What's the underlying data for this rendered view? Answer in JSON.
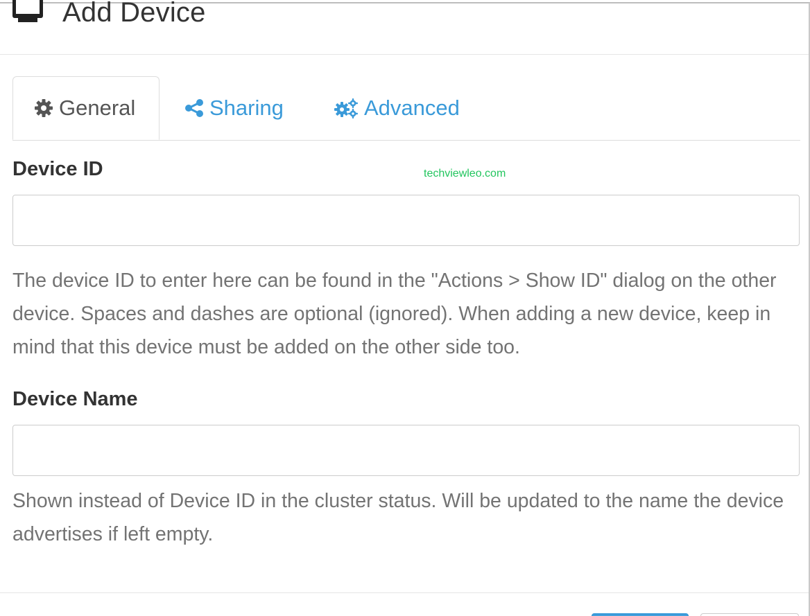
{
  "header": {
    "title": "Add Device",
    "icon": "desktop-icon"
  },
  "tabs": [
    {
      "label": "General",
      "icon": "gear-icon",
      "active": true
    },
    {
      "label": "Sharing",
      "icon": "share-icon",
      "active": false
    },
    {
      "label": "Advanced",
      "icon": "cogs-icon",
      "active": false
    }
  ],
  "form": {
    "device_id": {
      "label": "Device ID",
      "value": "",
      "help": "The device ID to enter here can be found in the \"Actions > Show ID\" dialog on the other device. Spaces and dashes are optional (ignored). When adding a new device, keep in mind that this device must be added on the other side too."
    },
    "device_name": {
      "label": "Device Name",
      "value": "",
      "help": "Shown instead of Device ID in the cluster status. Will be updated to the name the device advertises if left empty."
    }
  },
  "watermark": "techviewleo.com",
  "colors": {
    "link": "#3a9ad9",
    "text": "#333333",
    "help_text": "#737373",
    "watermark": "#22c55e"
  }
}
